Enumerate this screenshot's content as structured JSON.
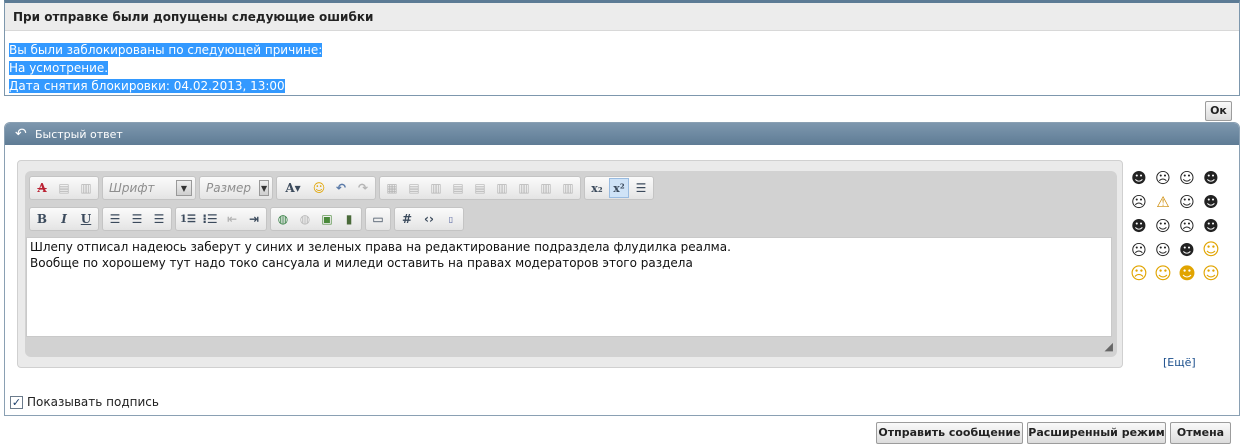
{
  "error": {
    "title": "При отправке были допущены следующие ошибки",
    "lines": [
      "Вы были заблокированы по следующей причине:",
      "На усмотрение.",
      "Дата снятия блокировки: 04.02.2013, 13:00"
    ],
    "ok_label": "Ок"
  },
  "quick_reply": {
    "title": "Быстрый ответ",
    "font_placeholder": "Шрифт",
    "size_placeholder": "Размер",
    "text_line1": "Шлепу отписал надеюсь заберут у синих и зеленых права на редактирование подраздела флудилка реалма.",
    "text_line2": "Вообще по хорошему тут надо токо сансуала и миледи оставить на правах модераторов этого раздела",
    "more_smilies": "[Ещё]",
    "show_signature_label": "Показывать подпись",
    "show_signature_checked": true
  },
  "buttons": {
    "send": "Отправить сообщение",
    "advanced": "Расширенный режим",
    "cancel": "Отмена"
  },
  "colors": {
    "header_blue": "#5f7c95",
    "selection": "#3399ff",
    "link": "#1a4e8c"
  }
}
